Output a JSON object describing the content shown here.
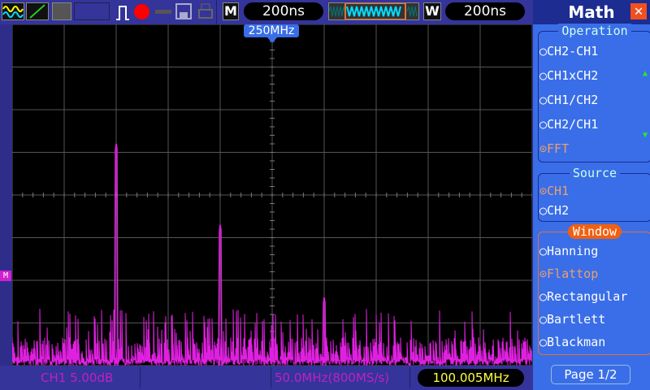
{
  "toolbar": {
    "timebase_label": "M",
    "timebase": "200ns",
    "window_label": "W",
    "window_time": "200ns",
    "center_freq_marker": "250MHz"
  },
  "status": {
    "channel_scale": "CH1 5.00dB",
    "freq_scale": "50.0MHz(800MS/s)",
    "readout": "100.005MHz",
    "marker": "M"
  },
  "sidebar": {
    "title": "Math",
    "operation": {
      "label": "Operation",
      "options": [
        "CH2-CH1",
        "CH1xCH2",
        "CH1/CH2",
        "CH2/CH1",
        "FFT"
      ],
      "selected": "FFT"
    },
    "source": {
      "label": "Source",
      "options": [
        "CH1",
        "CH2"
      ],
      "selected": "CH1"
    },
    "window": {
      "label": "Window",
      "options": [
        "Hanning",
        "Flattop",
        "Rectangular",
        "Bartlett",
        "Blackman"
      ],
      "selected": "Flattop"
    },
    "page": "Page 1/2"
  },
  "spectrum": {
    "color": "#e020e0",
    "span_mhz": [
      0,
      500
    ],
    "peaks": [
      {
        "freq_mhz": 100,
        "level_div": 5.2
      },
      {
        "freq_mhz": 200,
        "level_div": 3.3
      },
      {
        "freq_mhz": 300,
        "level_div": 1.6
      }
    ]
  }
}
